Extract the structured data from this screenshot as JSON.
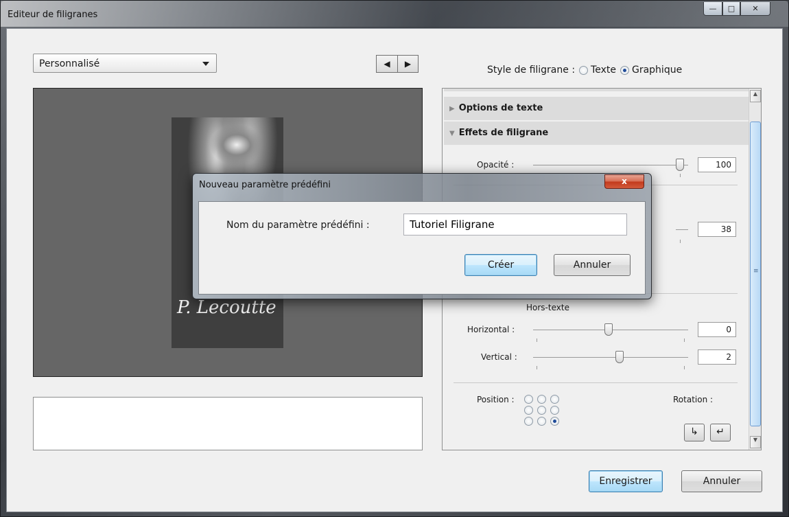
{
  "window": {
    "title": "Editeur de filigranes",
    "min_glyph": "—",
    "max_glyph": "□",
    "close_glyph": "✕"
  },
  "preset": {
    "selected": "Personnalisé"
  },
  "nav": {
    "prev_glyph": "◀",
    "next_glyph": "▶"
  },
  "preview": {
    "watermark_text": "P. Lecoutte"
  },
  "style": {
    "label": "Style de filigrane :",
    "options": [
      {
        "label": "Texte",
        "selected": false
      },
      {
        "label": "Graphique",
        "selected": true
      }
    ]
  },
  "panel": {
    "sections": [
      {
        "label": "Options de texte",
        "expanded": false
      },
      {
        "label": "Effets de filigrane",
        "expanded": true
      }
    ],
    "opacity": {
      "label": "Opacité :",
      "value": "100",
      "fraction": 1.0
    },
    "size": {
      "value": "38"
    },
    "offset": {
      "title": "Hors-texte",
      "horizontal": {
        "label": "Horizontal :",
        "value": "0",
        "fraction": 0.5
      },
      "vertical": {
        "label": "Vertical :",
        "value": "2",
        "fraction": 0.58
      }
    },
    "position": {
      "label": "Position :",
      "selected_index": 8
    },
    "rotation": {
      "label": "Rotation :",
      "cw_glyph": "↳",
      "ccw_glyph": "↵"
    }
  },
  "dialog": {
    "title": "Nouveau paramètre prédéfini",
    "close_glyph": "x",
    "field_label": "Nom du paramètre prédéfini :",
    "field_value": "Tutoriel Filigrane",
    "create_label": "Créer",
    "cancel_label": "Annuler"
  },
  "footer": {
    "save_label": "Enregistrer",
    "cancel_label": "Annuler"
  }
}
